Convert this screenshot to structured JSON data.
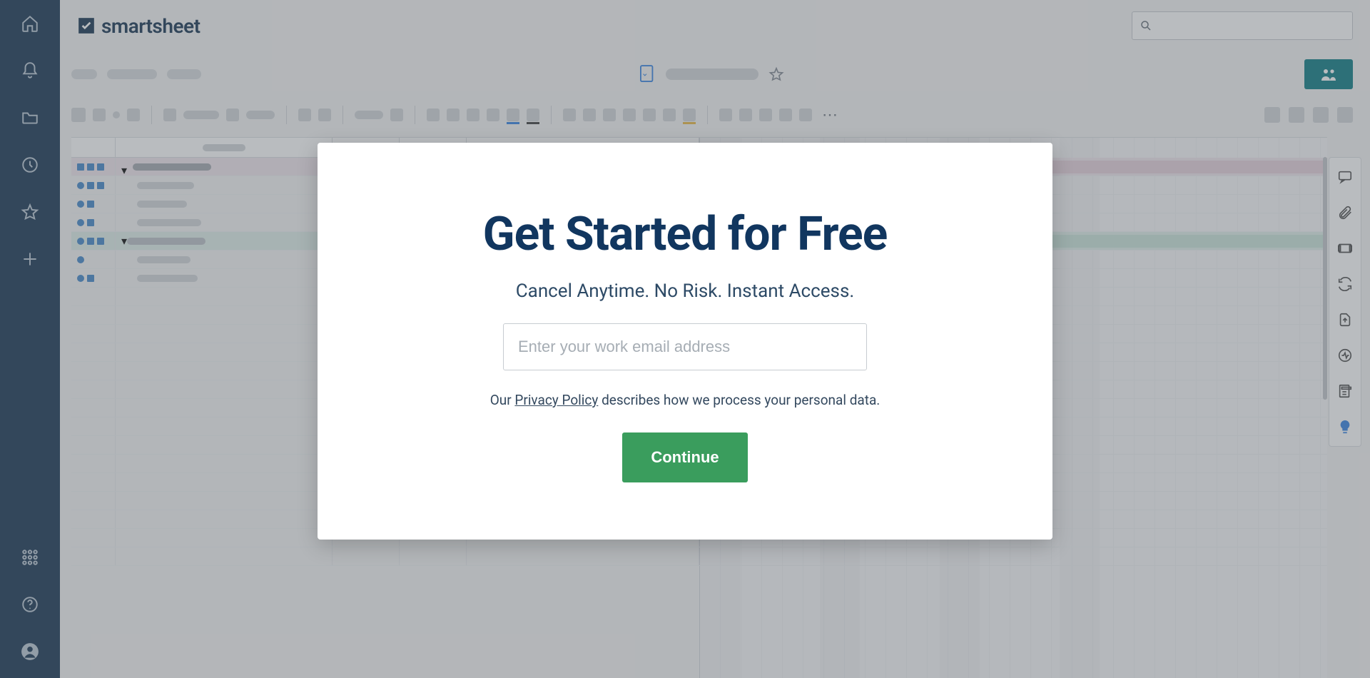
{
  "brand": {
    "name": "smartsheet"
  },
  "search": {
    "placeholder": ""
  },
  "toolbar": {
    "more": "⋯"
  },
  "modal": {
    "title": "Get Started for Free",
    "subtitle": "Cancel Anytime. No Risk. Instant Access.",
    "email_placeholder": "Enter your work email address",
    "privacy_pre": "Our ",
    "privacy_link": "Privacy Policy",
    "privacy_post": " describes how we process your personal data.",
    "continue": "Continue"
  }
}
